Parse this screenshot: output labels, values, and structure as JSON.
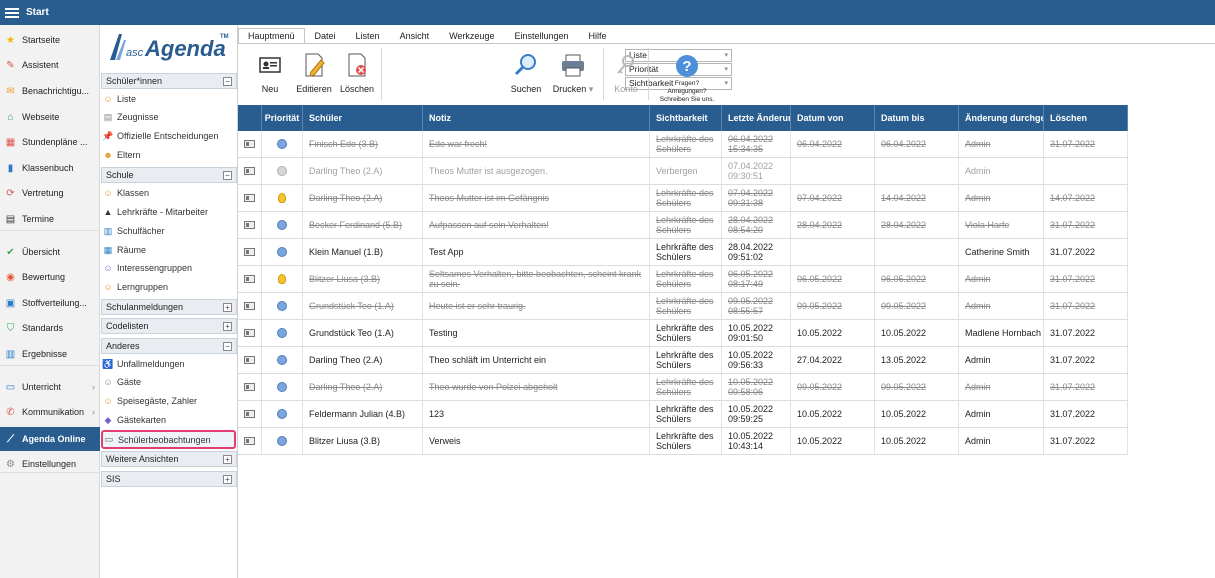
{
  "topbar": {
    "title": "Start"
  },
  "nav": [
    {
      "label": "Startseite",
      "icon": "star-icon",
      "glyph": "★",
      "color": "#f2b705"
    },
    {
      "label": "Assistent",
      "icon": "wand-icon",
      "glyph": "✎",
      "color": "#d9534f"
    },
    {
      "label": "Benachrichtigu...",
      "icon": "mail-icon",
      "glyph": "✉",
      "color": "#f0a030"
    },
    {
      "label": "Webseite",
      "icon": "home-icon",
      "glyph": "⌂",
      "color": "#2e9e6a"
    },
    {
      "label": "Stundenpläne ...",
      "icon": "timetable-icon",
      "glyph": "▦",
      "color": "#e05050"
    },
    {
      "label": "Klassenbuch",
      "icon": "book-icon",
      "glyph": "▮",
      "color": "#2a7ac8"
    },
    {
      "label": "Vertretung",
      "icon": "substitution-icon",
      "glyph": "⟳",
      "color": "#d9534f"
    },
    {
      "label": "Termine",
      "icon": "calendar-icon",
      "glyph": "▤",
      "color": "#333333"
    },
    {
      "label": "Übersicht",
      "icon": "check-icon",
      "glyph": "✔",
      "color": "#3aa856"
    },
    {
      "label": "Bewertung",
      "icon": "rating-icon",
      "glyph": "◉",
      "color": "#e8562f"
    },
    {
      "label": "Stoffverteilung...",
      "icon": "briefcase-icon",
      "glyph": "▣",
      "color": "#2a7ac8"
    },
    {
      "label": "Standards",
      "icon": "shield-icon",
      "glyph": "⛉",
      "color": "#3aa856"
    },
    {
      "label": "Ergebnisse",
      "icon": "bar-chart-icon",
      "glyph": "▥",
      "color": "#2a7ac8"
    },
    {
      "label": "Unterricht",
      "icon": "board-icon",
      "glyph": "▭",
      "color": "#2a7ac8"
    },
    {
      "label": "Kommunikation",
      "icon": "chat-icon",
      "glyph": "✆",
      "color": "#d9534f"
    },
    {
      "label": "Agenda Online",
      "icon": "agenda-logo-icon",
      "glyph": "⟋",
      "color": "#ffffff"
    },
    {
      "label": "Einstellungen",
      "icon": "gear-icon",
      "glyph": "⚙",
      "color": "#888888"
    }
  ],
  "logo": {
    "prefix": "asc",
    "name": "Agenda",
    "tm": "TM"
  },
  "subnav": {
    "sections": [
      {
        "label": "Schüler*innen",
        "toggle": "−"
      },
      {
        "label": "Schule",
        "toggle": "−"
      },
      {
        "label": "Schulanmeldungen",
        "toggle": "+"
      },
      {
        "label": "Codelisten",
        "toggle": "+"
      },
      {
        "label": "Anderes",
        "toggle": "−"
      },
      {
        "label": "Weitere Ansichten",
        "toggle": "+"
      },
      {
        "label": "SIS",
        "toggle": "+"
      }
    ],
    "items": [
      {
        "label": "Liste",
        "icon": "student-icon",
        "glyph": "☺",
        "color": "#e09a30"
      },
      {
        "label": "Zeugnisse",
        "icon": "report-icon",
        "glyph": "▤",
        "color": "#888888"
      },
      {
        "label": "Offizielle Entscheidungen",
        "icon": "pin-icon",
        "glyph": "📌",
        "color": "#d9534f"
      },
      {
        "label": "Eltern",
        "icon": "parents-icon",
        "glyph": "☻",
        "color": "#e09a30"
      },
      {
        "label": "Klassen",
        "icon": "classes-icon",
        "glyph": "☺",
        "color": "#e09a30"
      },
      {
        "label": "Lehrkräfte - Mitarbeiter",
        "icon": "teacher-icon",
        "glyph": "▲",
        "color": "#333333"
      },
      {
        "label": "Schulfächer",
        "icon": "subjects-icon",
        "glyph": "▥",
        "color": "#2a7ac8"
      },
      {
        "label": "Räume",
        "icon": "rooms-icon",
        "glyph": "▦",
        "color": "#2a7ac8"
      },
      {
        "label": "Interessengruppen",
        "icon": "groups-icon",
        "glyph": "☺",
        "color": "#7a5fc8"
      },
      {
        "label": "Lerngruppen",
        "icon": "learning-groups-icon",
        "glyph": "☺",
        "color": "#e09a30"
      },
      {
        "label": "Unfallmeldungen",
        "icon": "accident-icon",
        "glyph": "♿",
        "color": "#2a7ac8"
      },
      {
        "label": "Gäste",
        "icon": "guests-icon",
        "glyph": "☺",
        "color": "#888888"
      },
      {
        "label": "Speisegäste, Zahler",
        "icon": "meal-guests-icon",
        "glyph": "☺",
        "color": "#e09a30"
      },
      {
        "label": "Gästekarten",
        "icon": "guest-card-icon",
        "glyph": "◆",
        "color": "#7a5fc8"
      },
      {
        "label": "Schülerbeobachtungen",
        "icon": "observation-card-icon",
        "glyph": "▭",
        "color": "#555555"
      }
    ]
  },
  "menu_tabs": [
    "Hauptmenü",
    "Datei",
    "Listen",
    "Ansicht",
    "Werkzeuge",
    "Einstellungen",
    "Hilfe"
  ],
  "ribbon": {
    "new": "Neu",
    "edit": "Editieren",
    "delete": "Löschen",
    "filters": [
      "Liste",
      "Priorität",
      "Sichtbarkeit"
    ],
    "search": "Suchen",
    "print": "Drucken",
    "account": "Konto",
    "help_line1": "Fragen?",
    "help_line2": "Anregungen?",
    "help_line3": "Schreiben Sie uns."
  },
  "grid": {
    "headers": [
      "",
      "Priorität",
      "Schüler",
      "Notiz",
      "Sichtbarkeit",
      "Letzte Änderung",
      "Datum von",
      "Datum bis",
      "Änderung durchgeführt",
      "Löschen"
    ],
    "rows": [
      {
        "state": "struck",
        "prio": "info",
        "student": "Finisch Edo (3.B)",
        "note": "Edo war frech!",
        "vis": "Lehrkräfte des Schülers",
        "changed_date": "06.04.2022",
        "changed_time": "15:34:35",
        "from": "06.04.2022",
        "to": "06.04.2022",
        "by": "Admin",
        "del": "31.07.2022"
      },
      {
        "state": "hidden",
        "prio": "grey",
        "student": "Darling Theo (2.A)",
        "note": "Theos Mutter ist ausgezogen.",
        "vis": "Verbergen",
        "changed_date": "07.04.2022",
        "changed_time": "09:30:51",
        "from": "",
        "to": "",
        "by": "Admin",
        "del": ""
      },
      {
        "state": "struck",
        "prio": "bulb",
        "student": "Darling Theo (2.A)",
        "note": "Theos Mutter ist im Gefängnis",
        "vis": "Lehrkräfte des Schülers",
        "changed_date": "07.04.2022",
        "changed_time": "09:31:38",
        "from": "07.04.2022",
        "to": "14.04.2022",
        "by": "Admin",
        "del": "14.07.2022"
      },
      {
        "state": "struck",
        "prio": "info",
        "student": "Becker Ferdinand (5.B)",
        "note": "Aufpassen auf sein Verhalten!",
        "vis": "Lehrkräfte des Schülers",
        "changed_date": "28.04.2022",
        "changed_time": "08:54:20",
        "from": "28.04.2022",
        "to": "28.04.2022",
        "by": "Viola Harfe",
        "del": "31.07.2022"
      },
      {
        "state": "normal",
        "prio": "info",
        "student": "Klein Manuel (1.B)",
        "note": "Test App",
        "vis": "Lehrkräfte des Schülers",
        "changed_date": "28.04.2022",
        "changed_time": "09:51:02",
        "from": "",
        "to": "",
        "by": "Catherine Smith",
        "del": "31.07.2022"
      },
      {
        "state": "struck",
        "prio": "bulb",
        "student": "Blitzer Liusa (3.B)",
        "note": "Seltsames Verhalten, bitte beobachten, scheint krank zu sein.",
        "vis": "Lehrkräfte des Schülers",
        "changed_date": "06.05.2022",
        "changed_time": "08:17:49",
        "from": "06.05.2022",
        "to": "06.05.2022",
        "by": "Admin",
        "del": "31.07.2022"
      },
      {
        "state": "struck",
        "prio": "info",
        "student": "Grundstück Teo (1.A)",
        "note": "Heute ist er sehr traurig.",
        "vis": "Lehrkräfte des Schülers",
        "changed_date": "09.05.2022",
        "changed_time": "08:55:57",
        "from": "09.05.2022",
        "to": "09.05.2022",
        "by": "Admin",
        "del": "31.07.2022"
      },
      {
        "state": "normal",
        "prio": "info",
        "student": "Grundstück Teo (1.A)",
        "note": "Testing",
        "vis": "Lehrkräfte des Schülers",
        "changed_date": "10.05.2022",
        "changed_time": "09:01:50",
        "from": "10.05.2022",
        "to": "10.05.2022",
        "by": "Madlene Hornbach",
        "del": "31.07.2022"
      },
      {
        "state": "normal",
        "prio": "info",
        "student": "Darling Theo (2.A)",
        "note": "Theo schläft im Unterricht ein",
        "vis": "Lehrkräfte des Schülers",
        "changed_date": "10.05.2022",
        "changed_time": "09:56:33",
        "from": "27.04.2022",
        "to": "13.05.2022",
        "by": "Admin",
        "del": "31.07.2022"
      },
      {
        "state": "struck",
        "prio": "info",
        "student": "Darling Theo (2.A)",
        "note": "Theo wurde von Polzei abgeholt",
        "vis": "Lehrkräfte des Schülers",
        "changed_date": "10.05.2022",
        "changed_time": "09:58:06",
        "from": "09.05.2022",
        "to": "09.05.2022",
        "by": "Admin",
        "del": "31.07.2022"
      },
      {
        "state": "normal",
        "prio": "info",
        "student": "Feldermann Julian (4.B)",
        "note": "123",
        "vis": "Lehrkräfte des Schülers",
        "changed_date": "10.05.2022",
        "changed_time": "09:59:25",
        "from": "10.05.2022",
        "to": "10.05.2022",
        "by": "Admin",
        "del": "31.07.2022"
      },
      {
        "state": "normal",
        "prio": "info",
        "student": "Blitzer Liusa (3.B)",
        "note": "Verweis",
        "vis": "Lehrkräfte des Schülers",
        "changed_date": "10.05.2022",
        "changed_time": "10:43:14",
        "from": "10.05.2022",
        "to": "10.05.2022",
        "by": "Admin",
        "del": "31.07.2022"
      }
    ]
  },
  "colors": {
    "header_bg": "#2a5d8f",
    "accent": "#2a5d8f",
    "highlight": "#e23d6e"
  }
}
